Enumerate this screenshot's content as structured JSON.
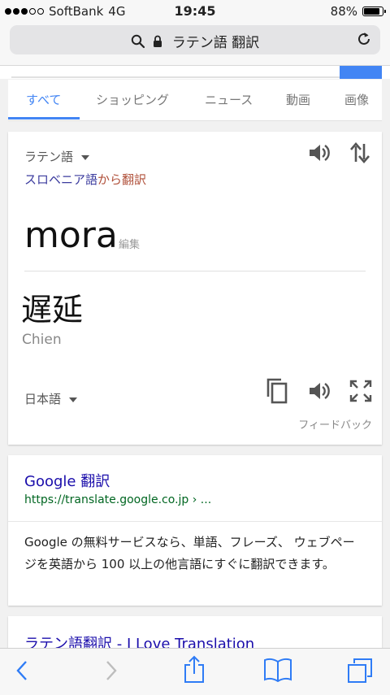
{
  "status": {
    "carrier": "SoftBank",
    "network": "4G",
    "time": "19:45",
    "battery": "88%",
    "battery_level": 0.88,
    "signal_bars_filled": 3,
    "signal_bars_total": 5
  },
  "urlbar": {
    "title": "ラテン語 翻訳",
    "icons": [
      "search-icon",
      "lock-icon",
      "reload-icon"
    ]
  },
  "tabs": [
    {
      "label": "すべて",
      "active": true
    },
    {
      "label": "ショッピング",
      "active": false
    },
    {
      "label": "ニュース",
      "active": false
    },
    {
      "label": "動画",
      "active": false
    },
    {
      "label": "画像",
      "active": false
    }
  ],
  "translate": {
    "source_lang": "ラテン語",
    "detected_lang": "スロベニア語",
    "detected_suffix": "から翻訳",
    "source_text": "mora",
    "edit_label": "編集",
    "result_text": "遅延",
    "romanization": "Chien",
    "target_lang": "日本語",
    "feedback_label": "フィードバック",
    "colors": {
      "accent": "#4285f4",
      "detected": "#3b3b9e",
      "from": "#b0503a"
    }
  },
  "results": [
    {
      "title": "Google 翻訳",
      "url": "https://translate.google.co.jp › ...",
      "snippet": "Google の無料サービスなら、単語、フレーズ、 ウェブページを英語から 100 以上の他言語にすぐに翻訳できます。"
    },
    {
      "title": "ラテン語翻訳 - I Love Translation"
    }
  ],
  "toolbar": {
    "icons": [
      "back-icon",
      "forward-icon",
      "share-icon",
      "bookmarks-icon",
      "tabs-icon"
    ]
  }
}
